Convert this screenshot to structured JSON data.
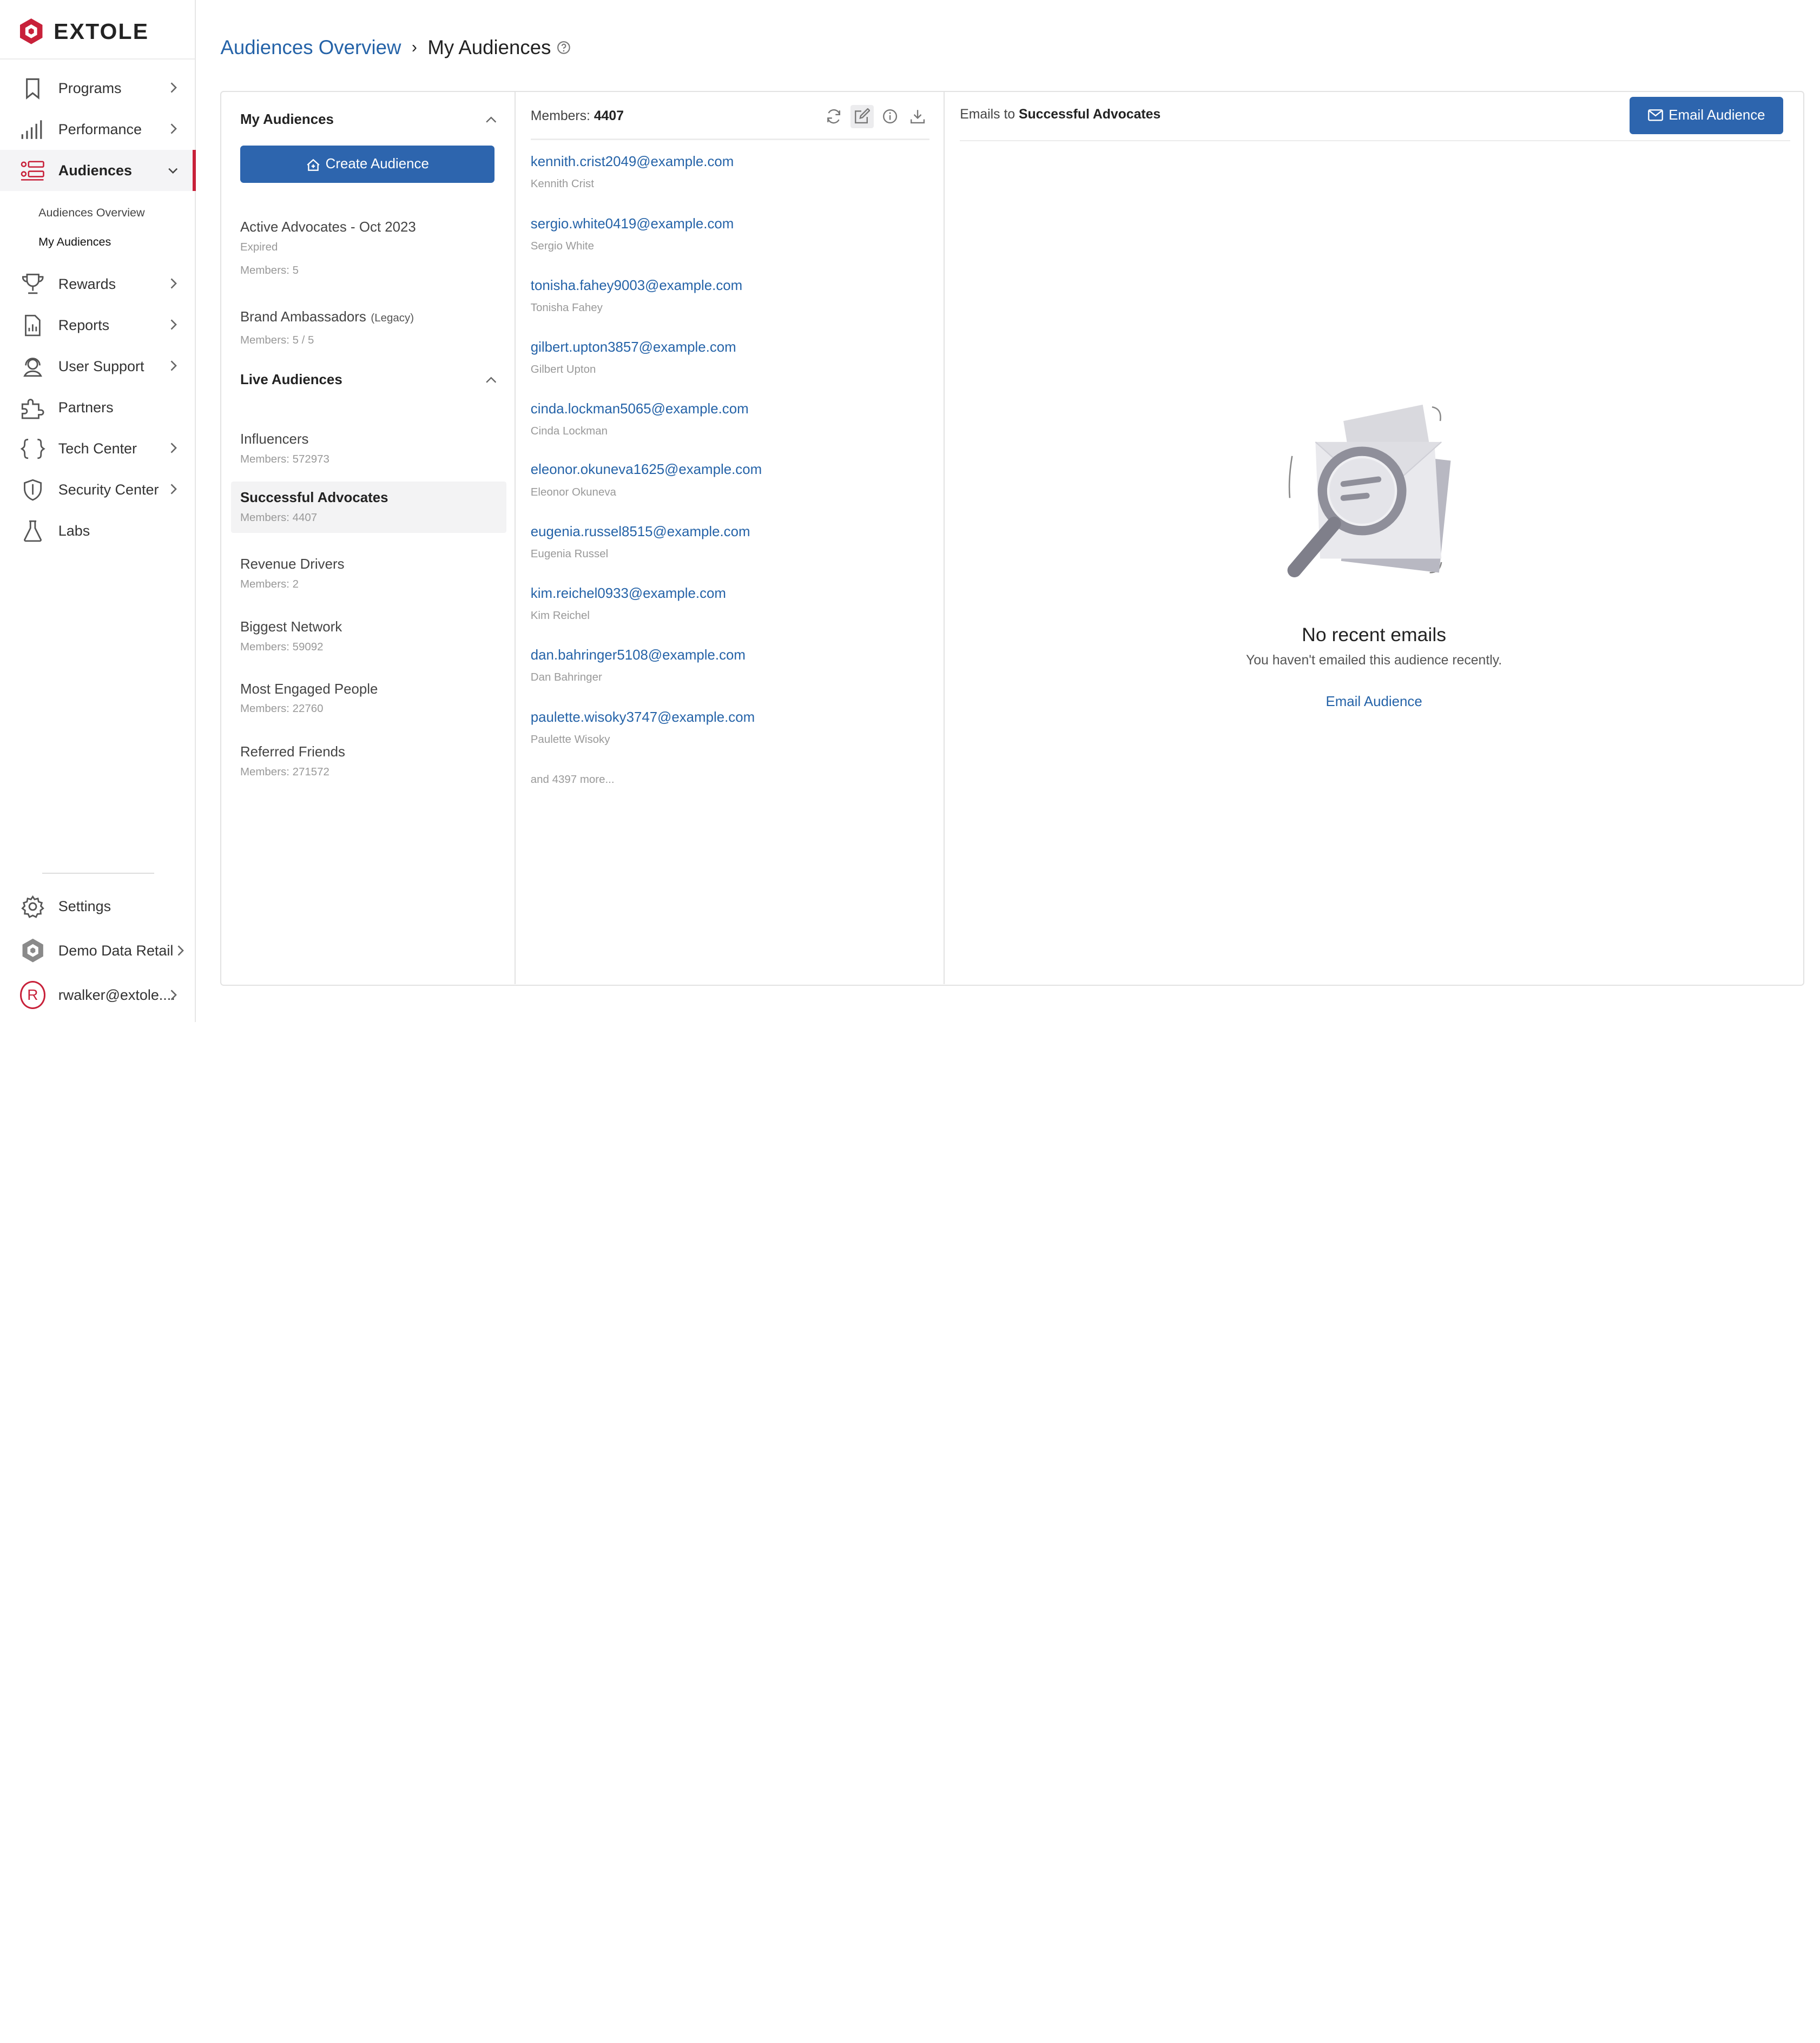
{
  "brand": {
    "name": "EXTOLE",
    "accent": "#c8213a",
    "primary": "#2d65ae",
    "link": "#2563a8"
  },
  "sidebar": {
    "items": [
      {
        "label": "Programs",
        "icon": "bookmark-icon",
        "has_chevron": true
      },
      {
        "label": "Performance",
        "icon": "bar-chart-icon",
        "has_chevron": true
      },
      {
        "label": "Audiences",
        "icon": "audiences-icon",
        "has_chevron": true,
        "active": true,
        "expanded": true
      },
      {
        "label": "Rewards",
        "icon": "trophy-icon",
        "has_chevron": true
      },
      {
        "label": "Reports",
        "icon": "report-icon",
        "has_chevron": true
      },
      {
        "label": "User Support",
        "icon": "headset-icon",
        "has_chevron": true
      },
      {
        "label": "Partners",
        "icon": "puzzle-icon",
        "has_chevron": false
      },
      {
        "label": "Tech Center",
        "icon": "braces-icon",
        "has_chevron": true
      },
      {
        "label": "Security Center",
        "icon": "shield-icon",
        "has_chevron": true
      },
      {
        "label": "Labs",
        "icon": "flask-icon",
        "has_chevron": false
      }
    ],
    "sub_items": [
      {
        "label": "Audiences Overview"
      },
      {
        "label": "My Audiences",
        "current": true
      }
    ],
    "bottom": {
      "settings": "Settings",
      "account": "Demo Data Retail",
      "user_email": "rwalker@extole....",
      "user_initial": "R"
    }
  },
  "breadcrumb": {
    "parent": "Audiences Overview",
    "current": "My Audiences"
  },
  "left_panel": {
    "my_audiences_title": "My Audiences",
    "create_label": "Create Audience",
    "my_audiences": [
      {
        "name": "Active Advocates - Oct 2023",
        "status": "Expired",
        "members": "Members: 5"
      },
      {
        "name": "Brand Ambassadors",
        "tag": "(Legacy)",
        "members": "Members: 5  / 5"
      }
    ],
    "live_title": "Live Audiences",
    "live_audiences": [
      {
        "name": "Influencers",
        "members": "Members: 572973"
      },
      {
        "name": "Successful Advocates",
        "members": "Members: 4407",
        "selected": true
      },
      {
        "name": "Revenue Drivers",
        "members": "Members: 2"
      },
      {
        "name": "Biggest Network",
        "members": "Members: 59092"
      },
      {
        "name": "Most Engaged People",
        "members": "Members: 22760"
      },
      {
        "name": "Referred Friends",
        "members": "Members: 271572"
      }
    ]
  },
  "members_panel": {
    "label": "Members:",
    "count": "4407",
    "members": [
      {
        "email": "kennith.crist2049@example.com",
        "name": "Kennith Crist"
      },
      {
        "email": "sergio.white0419@example.com",
        "name": "Sergio White"
      },
      {
        "email": "tonisha.fahey9003@example.com",
        "name": "Tonisha Fahey"
      },
      {
        "email": "gilbert.upton3857@example.com",
        "name": "Gilbert Upton"
      },
      {
        "email": "cinda.lockman5065@example.com",
        "name": "Cinda Lockman"
      },
      {
        "email": "eleonor.okuneva1625@example.com",
        "name": "Eleonor Okuneva"
      },
      {
        "email": "eugenia.russel8515@example.com",
        "name": "Eugenia Russel"
      },
      {
        "email": "kim.reichel0933@example.com",
        "name": "Kim Reichel"
      },
      {
        "email": "dan.bahringer5108@example.com",
        "name": "Dan Bahringer"
      },
      {
        "email": "paulette.wisoky3747@example.com",
        "name": "Paulette Wisoky"
      }
    ],
    "more": "and 4397 more..."
  },
  "emails_panel": {
    "prefix": "Emails to",
    "audience": "Successful Advocates",
    "button_label": "Email Audience",
    "empty_title": "No recent emails",
    "empty_subtitle": "You haven't emailed this audience recently.",
    "empty_link": "Email Audience"
  }
}
